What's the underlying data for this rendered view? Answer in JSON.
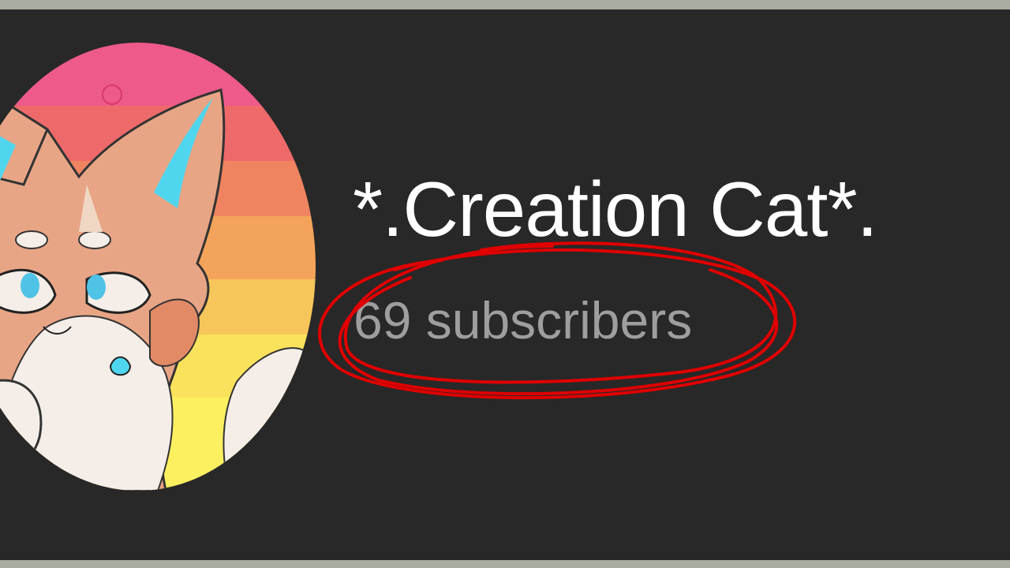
{
  "channel": {
    "name": "*.Creation Cat*.",
    "subscribers": "69 subscribers",
    "avatar_icon": "cat-avatar-icon"
  },
  "annotation": {
    "shape": "scribbled circle",
    "color": "#e00000",
    "target": "subscribers"
  },
  "colors": {
    "background": "#282828",
    "border": "#a9ad9f",
    "name_text": "#ffffff",
    "subscriber_text": "#9e9e9e"
  }
}
